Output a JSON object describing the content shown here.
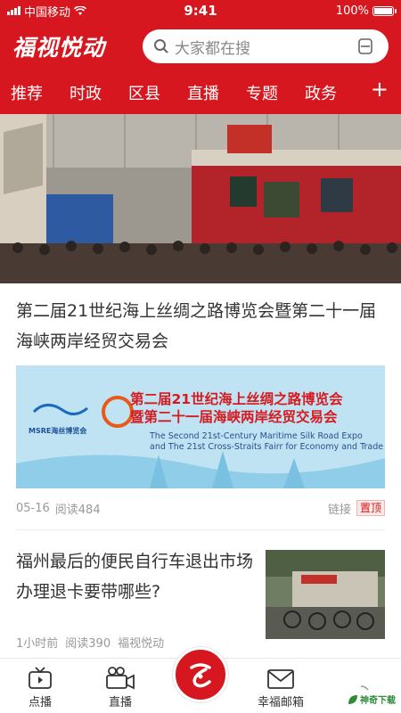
{
  "status_bar": {
    "carrier": "中国移动",
    "time": "9:41",
    "battery": "100%",
    "battery_level": 1.0
  },
  "header": {
    "logo": "福视悦动",
    "search_placeholder": "大家都在搜"
  },
  "nav": {
    "items": [
      "推荐",
      "时政",
      "区县",
      "直播",
      "专题",
      "政务"
    ],
    "more": "+"
  },
  "article1": {
    "title": "第二届21世纪海上丝绸之路博览会暨第二十一届海峡两岸经贸交易会",
    "banner": {
      "title_line1": "第二届21世纪海上丝绸之路博览会",
      "title_line2": "暨第二十一届海峡两岸经贸交易会",
      "en_line1": "The Second 21st-Century Maritime  Silk Road Expo",
      "en_line2": "and The 21st Cross-Straits Fairr for Economy and Trade",
      "org": "MSRE海丝博览会"
    },
    "date": "05-16",
    "reads": "阅读484",
    "type": "链接",
    "badge": "置顶"
  },
  "article2": {
    "title": "福州最后的便民自行车退出市场 办理退卡要带哪些?",
    "time": "1小时前",
    "reads": "阅读390",
    "source": "福视悦动"
  },
  "tabbar": {
    "items": [
      {
        "label": "点播",
        "icon": "tv-icon"
      },
      {
        "label": "直播",
        "icon": "video-camera-icon"
      },
      {
        "label": "",
        "icon": "fu-logo-icon"
      },
      {
        "label": "幸福邮箱",
        "icon": "mail-icon"
      },
      {
        "label": "",
        "icon": "loading-icon"
      }
    ]
  },
  "watermark": "神奇下载",
  "colors": {
    "brand_red": "#d6171f",
    "text": "#333333",
    "meta": "#999999"
  }
}
